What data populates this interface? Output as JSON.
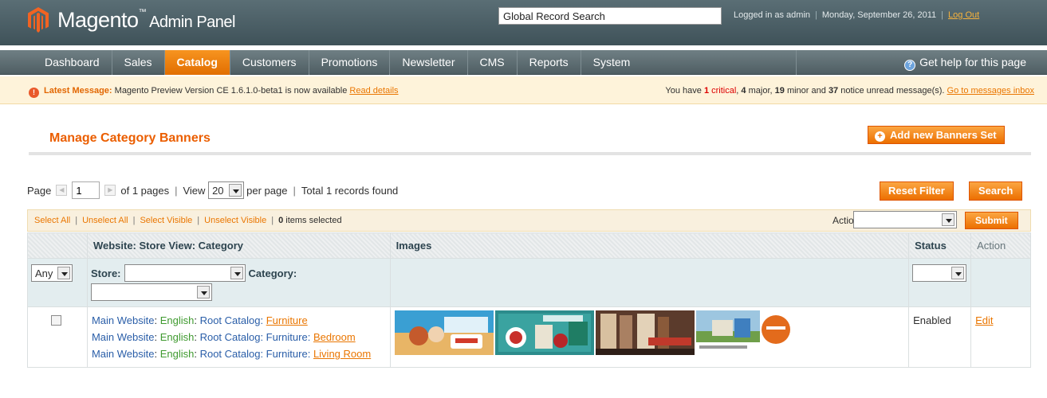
{
  "header": {
    "logo_text": "Magento",
    "logo_tm": "™",
    "logo_sub": "Admin Panel",
    "search_placeholder": "Global Record Search",
    "logged_in": "Logged in as admin",
    "date": "Monday, September 26, 2011",
    "logout": "Log Out"
  },
  "nav": {
    "items": [
      "Dashboard",
      "Sales",
      "Catalog",
      "Customers",
      "Promotions",
      "Newsletter",
      "CMS",
      "Reports",
      "System"
    ],
    "active": "Catalog",
    "help": "Get help for this page"
  },
  "notice": {
    "latest_label": "Latest Message:",
    "latest_text": "Magento Preview Version CE 1.6.1.0-beta1 is now available",
    "read_details": "Read details",
    "summary_prefix": "You have",
    "critical_count": "1",
    "critical_word": "critical",
    "major_count": "4",
    "major_text": "major,",
    "minor_count": "19",
    "minor_text": "minor and",
    "notice_count": "37",
    "notice_text": "notice unread message(s).",
    "inbox_link": "Go to messages inbox"
  },
  "page": {
    "title": "Manage Category Banners",
    "add_button": "Add new Banners Set"
  },
  "pager": {
    "page_label": "Page",
    "page_value": "1",
    "of_pages": "of 1 pages",
    "view_label": "View",
    "per_page_value": "20",
    "per_page_label": "per page",
    "total": "Total 1 records found",
    "reset_filter": "Reset Filter",
    "search": "Search"
  },
  "massaction": {
    "select_all": "Select All",
    "unselect_all": "Unselect All",
    "select_visible": "Select Visible",
    "unselect_visible": "Unselect Visible",
    "items_selected_count": "0",
    "items_selected_text": "items selected",
    "actions_label": "Actions",
    "submit": "Submit"
  },
  "grid": {
    "headers": {
      "category": "Website: Store View: Category",
      "images": "Images",
      "status": "Status",
      "action": "Action"
    },
    "filters": {
      "massaction_value": "Any",
      "store_label": "Store:",
      "category_label": "Category:"
    },
    "rows": [
      {
        "lines": [
          {
            "website": "Main Website",
            "store": "English",
            "path": "Root Catalog:",
            "link": "Furniture"
          },
          {
            "website": "Main Website",
            "store": "English",
            "path": "Root Catalog: Furniture:",
            "link": "Bedroom"
          },
          {
            "website": "Main Website",
            "store": "English",
            "path": "Root Catalog: Furniture:",
            "link": "Living Room"
          }
        ],
        "status": "Enabled",
        "action": "Edit"
      }
    ]
  },
  "colors": {
    "accent": "#f18200",
    "header_bg": "#4c5f66",
    "title": "#eb5e00",
    "notice_bg": "#fef3da"
  }
}
